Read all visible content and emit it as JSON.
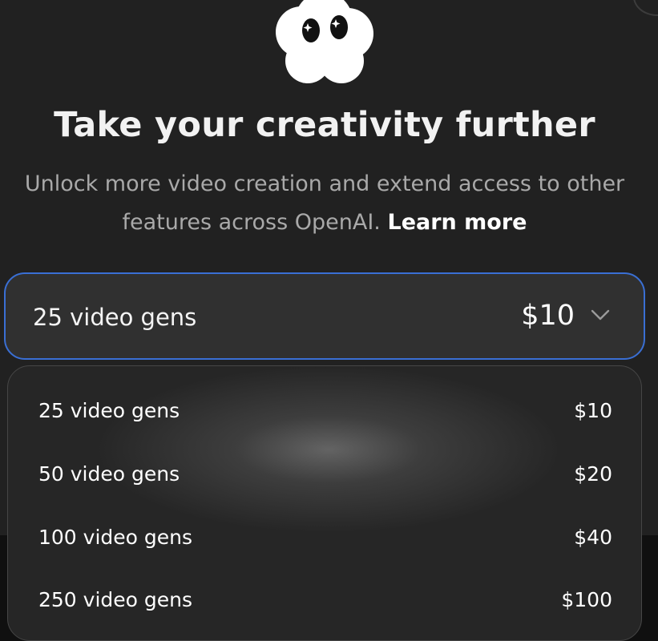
{
  "hero": {
    "icon": "mascot-cloud-icon",
    "title": "Take your creativity further",
    "subtitle": "Unlock more video creation and extend access to other features across OpenAI.",
    "learn_more": "Learn more"
  },
  "select": {
    "selected_label": "25 video gens",
    "selected_price": "$10",
    "icon": "chevron-down-icon",
    "accent": "#3a6fd4"
  },
  "options": [
    {
      "label": "25 video gens",
      "price": "$10"
    },
    {
      "label": "50 video gens",
      "price": "$20"
    },
    {
      "label": "100 video gens",
      "price": "$40"
    },
    {
      "label": "250 video gens",
      "price": "$100"
    }
  ]
}
